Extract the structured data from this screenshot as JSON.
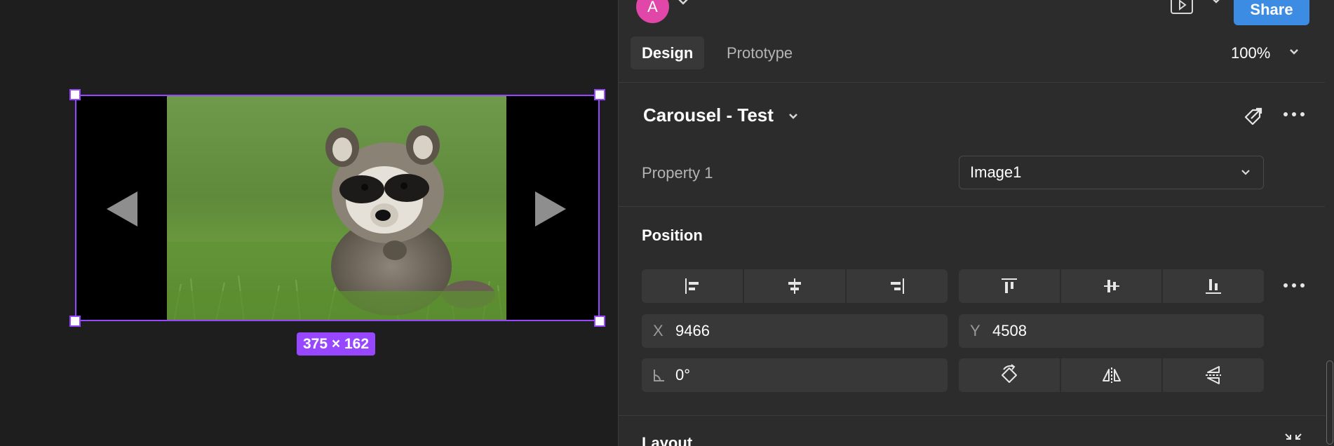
{
  "canvas": {
    "size_badge": "375 × 162",
    "accent": "#9747ff"
  },
  "header": {
    "avatar_initial": "A",
    "avatar_color": "#e047a8",
    "share_label": "Share",
    "share_color": "#3d8ce4"
  },
  "tabs": {
    "design": "Design",
    "prototype": "Prototype",
    "zoom": "100%"
  },
  "component": {
    "name": "Carousel - Test",
    "property_label": "Property 1",
    "property_value": "Image1"
  },
  "position": {
    "title": "Position",
    "x_label": "X",
    "x_value": "9466",
    "y_label": "Y",
    "y_value": "4508",
    "rotation_value": "0°"
  },
  "layout": {
    "title": "Layout"
  },
  "icons": {
    "carousel_prev": "triangle-left",
    "carousel_next": "triangle-right",
    "go_to_main": "diamond-arrow",
    "more": "ellipsis",
    "collapse": "collapse-arrows"
  }
}
